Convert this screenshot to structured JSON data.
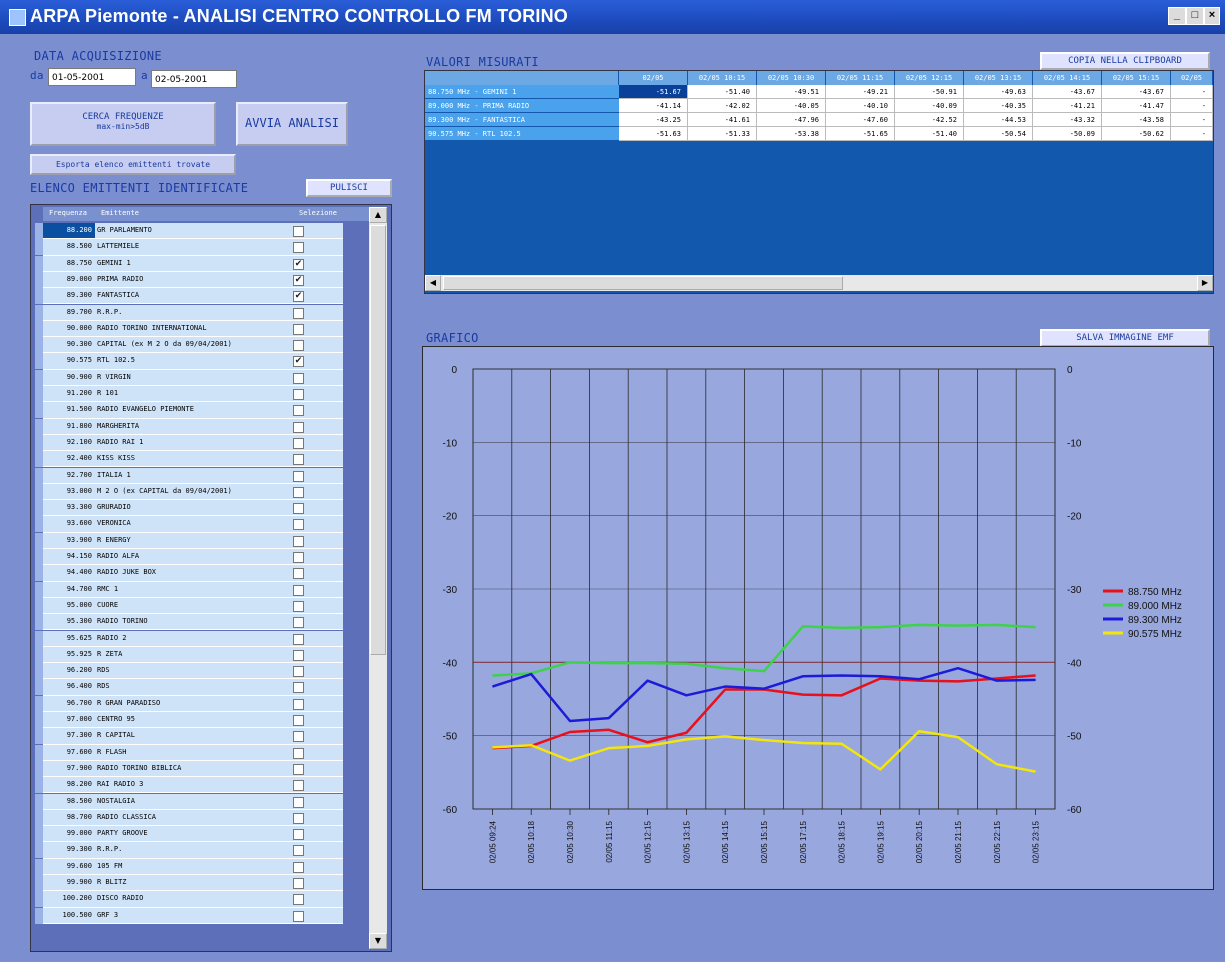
{
  "window": {
    "title": "ARPA Piemonte - ANALISI CENTRO CONTROLLO FM TORINO",
    "controls": [
      "_",
      "□",
      "×"
    ]
  },
  "acquisition": {
    "label": "DATA ACQUISIZIONE",
    "from_label": "da",
    "from_value": "01-05-2001",
    "to_label": "a",
    "to_value": "02-05-2001"
  },
  "buttons": {
    "search_line1": "CERCA FREQUENZE",
    "search_line2": "max-min>5dB",
    "analyze": "AVVIA ANALISI",
    "export": "Esporta elenco emittenti trovate",
    "clear": "PULISCI",
    "copy_clipboard": "COPIA NELLA CLIPBOARD",
    "save_image": "SALVA IMMAGINE EMF"
  },
  "emitters": {
    "section_label": "ELENCO EMITTENTI IDENTIFICATE",
    "col_frequency": "Frequenza",
    "col_emitter": "Emittente",
    "col_select": "Selezione",
    "rows": [
      {
        "freq": "88.200",
        "name": "GR PARLAMENTO",
        "checked": false,
        "selected": true
      },
      {
        "freq": "88.500",
        "name": "LATTEMIELE",
        "checked": false
      },
      {
        "freq": "88.750",
        "name": "GEMINI 1",
        "checked": true
      },
      {
        "freq": "89.000",
        "name": "PRIMA RADIO",
        "checked": true
      },
      {
        "freq": "89.300",
        "name": "FANTASTICA",
        "checked": true
      },
      {
        "freq": "89.700",
        "name": "R.R.P.",
        "checked": false
      },
      {
        "freq": "90.000",
        "name": "RADIO TORINO INTERNATIONAL",
        "checked": false
      },
      {
        "freq": "90.300",
        "name": "CAPITAL (ex M 2 O da 09/04/2001)",
        "checked": false
      },
      {
        "freq": "90.575",
        "name": "RTL 102.5",
        "checked": true
      },
      {
        "freq": "90.900",
        "name": "R VIRGIN",
        "checked": false
      },
      {
        "freq": "91.200",
        "name": "R 101",
        "checked": false
      },
      {
        "freq": "91.500",
        "name": "RADIO EVANGELO PIEMONTE",
        "checked": false
      },
      {
        "freq": "91.800",
        "name": "MARGHERITA",
        "checked": false
      },
      {
        "freq": "92.100",
        "name": "RADIO RAI 1",
        "checked": false
      },
      {
        "freq": "92.400",
        "name": "KISS KISS",
        "checked": false
      },
      {
        "freq": "92.700",
        "name": "ITALIA 1",
        "checked": false
      },
      {
        "freq": "93.000",
        "name": "M 2 O (ex CAPITAL da 09/04/2001)",
        "checked": false
      },
      {
        "freq": "93.300",
        "name": "GRURADIO",
        "checked": false
      },
      {
        "freq": "93.600",
        "name": "VERONICA",
        "checked": false
      },
      {
        "freq": "93.900",
        "name": "R ENERGY",
        "checked": false
      },
      {
        "freq": "94.150",
        "name": "RADIO ALFA",
        "checked": false
      },
      {
        "freq": "94.400",
        "name": "RADIO JUKE BOX",
        "checked": false
      },
      {
        "freq": "94.700",
        "name": "RMC 1",
        "checked": false
      },
      {
        "freq": "95.000",
        "name": "CUORE",
        "checked": false
      },
      {
        "freq": "95.300",
        "name": "RADIO TORINO",
        "checked": false
      },
      {
        "freq": "95.625",
        "name": "RADIO 2",
        "checked": false
      },
      {
        "freq": "95.925",
        "name": "R ZETA",
        "checked": false
      },
      {
        "freq": "96.200",
        "name": "RDS",
        "checked": false
      },
      {
        "freq": "96.400",
        "name": "RDS",
        "checked": false
      },
      {
        "freq": "96.700",
        "name": "R GRAN PARADISO",
        "checked": false
      },
      {
        "freq": "97.000",
        "name": "CENTRO 95",
        "checked": false
      },
      {
        "freq": "97.300",
        "name": "R CAPITAL",
        "checked": false
      },
      {
        "freq": "97.600",
        "name": "R FLASH",
        "checked": false
      },
      {
        "freq": "97.900",
        "name": "RADIO TORINO BIBLICA",
        "checked": false
      },
      {
        "freq": "98.200",
        "name": "RAI RADIO 3",
        "checked": false
      },
      {
        "freq": "98.500",
        "name": "NOSTALGIA",
        "checked": false
      },
      {
        "freq": "98.700",
        "name": "RADIO CLASSICA",
        "checked": false
      },
      {
        "freq": "99.000",
        "name": "PARTY GROOVE",
        "checked": false
      },
      {
        "freq": "99.300",
        "name": "R.R.P.",
        "checked": false
      },
      {
        "freq": "99.600",
        "name": "105 FM",
        "checked": false
      },
      {
        "freq": "99.900",
        "name": "R BLITZ",
        "checked": false
      },
      {
        "freq": "100.200",
        "name": "DISCO RADIO",
        "checked": false
      },
      {
        "freq": "100.500",
        "name": "GRF 3",
        "checked": false
      }
    ]
  },
  "measured": {
    "section_label": "VALORI MISURATI",
    "headers": [
      "02/05",
      "02/05 10:15",
      "02/05 10:30",
      "02/05 11:15",
      "02/05 12:15",
      "02/05 13:15",
      "02/05 14:15",
      "02/05 15:15",
      "02/05"
    ],
    "rows": [
      {
        "label": "88.750 MHz - GEMINI 1",
        "values": [
          "-51.67",
          "-51.40",
          "-49.51",
          "-49.21",
          "-50.91",
          "-49.63",
          "-43.67",
          "-43.67",
          "-"
        ]
      },
      {
        "label": "89.000 MHz - PRIMA RADIO",
        "values": [
          "-41.14",
          "-42.02",
          "-40.05",
          "-40.10",
          "-40.09",
          "-40.35",
          "-41.21",
          "-41.47",
          "-"
        ]
      },
      {
        "label": "89.300 MHz - FANTASTICA",
        "values": [
          "-43.25",
          "-41.61",
          "-47.96",
          "-47.60",
          "-42.52",
          "-44.53",
          "-43.32",
          "-43.58",
          "-"
        ]
      },
      {
        "label": "90.575 MHz - RTL 102.5",
        "values": [
          "-51.63",
          "-51.33",
          "-53.38",
          "-51.65",
          "-51.40",
          "-50.54",
          "-50.09",
          "-50.62",
          "-"
        ]
      }
    ]
  },
  "graph": {
    "section_label": "GRAFICO"
  },
  "chart_data": {
    "type": "line",
    "title": "",
    "xlabel": "",
    "ylabel": "",
    "ylim": [
      -60,
      0
    ],
    "yticks": [
      0,
      -10,
      -20,
      -30,
      -40,
      -50,
      -60
    ],
    "grid": true,
    "legend_position": "right",
    "x": [
      "02/05 09:24",
      "02/05 10:18",
      "02/05 10:30",
      "02/05 11:15",
      "02/05 12:15",
      "02/05 13:15",
      "02/05 14:15",
      "02/05 15:15",
      "02/05 17:15",
      "02/05 18:15",
      "02/05 19:15",
      "02/05 20:15",
      "02/05 21:15",
      "02/05 22:15",
      "02/05 23:15"
    ],
    "series": [
      {
        "name": "88.750 MHz",
        "color": "#e8101a",
        "values": [
          -51.7,
          -51.4,
          -49.5,
          -49.2,
          -50.9,
          -49.6,
          -43.7,
          -43.7,
          -44.4,
          -44.5,
          -42.2,
          -42.5,
          -42.6,
          -42.2,
          -41.8
        ]
      },
      {
        "name": "89.000 MHz",
        "color": "#3ed24a",
        "values": [
          -41.8,
          -41.5,
          -40.0,
          -40.1,
          -40.1,
          -40.2,
          -40.8,
          -41.2,
          -35.1,
          -35.3,
          -35.2,
          -34.9,
          -35.0,
          -34.9,
          -35.2
        ]
      },
      {
        "name": "89.300 MHz",
        "color": "#1b1bd8",
        "values": [
          -43.3,
          -41.6,
          -48.0,
          -47.6,
          -42.5,
          -44.5,
          -43.3,
          -43.6,
          -41.9,
          -41.8,
          -41.9,
          -42.3,
          -40.8,
          -42.5,
          -42.4
        ]
      },
      {
        "name": "90.575 MHz",
        "color": "#f2e60d",
        "values": [
          -51.6,
          -51.3,
          -53.4,
          -51.7,
          -51.4,
          -50.5,
          -50.1,
          -50.6,
          -51.0,
          -51.1,
          -54.6,
          -49.4,
          -50.2,
          -53.9,
          -54.9
        ]
      }
    ]
  }
}
